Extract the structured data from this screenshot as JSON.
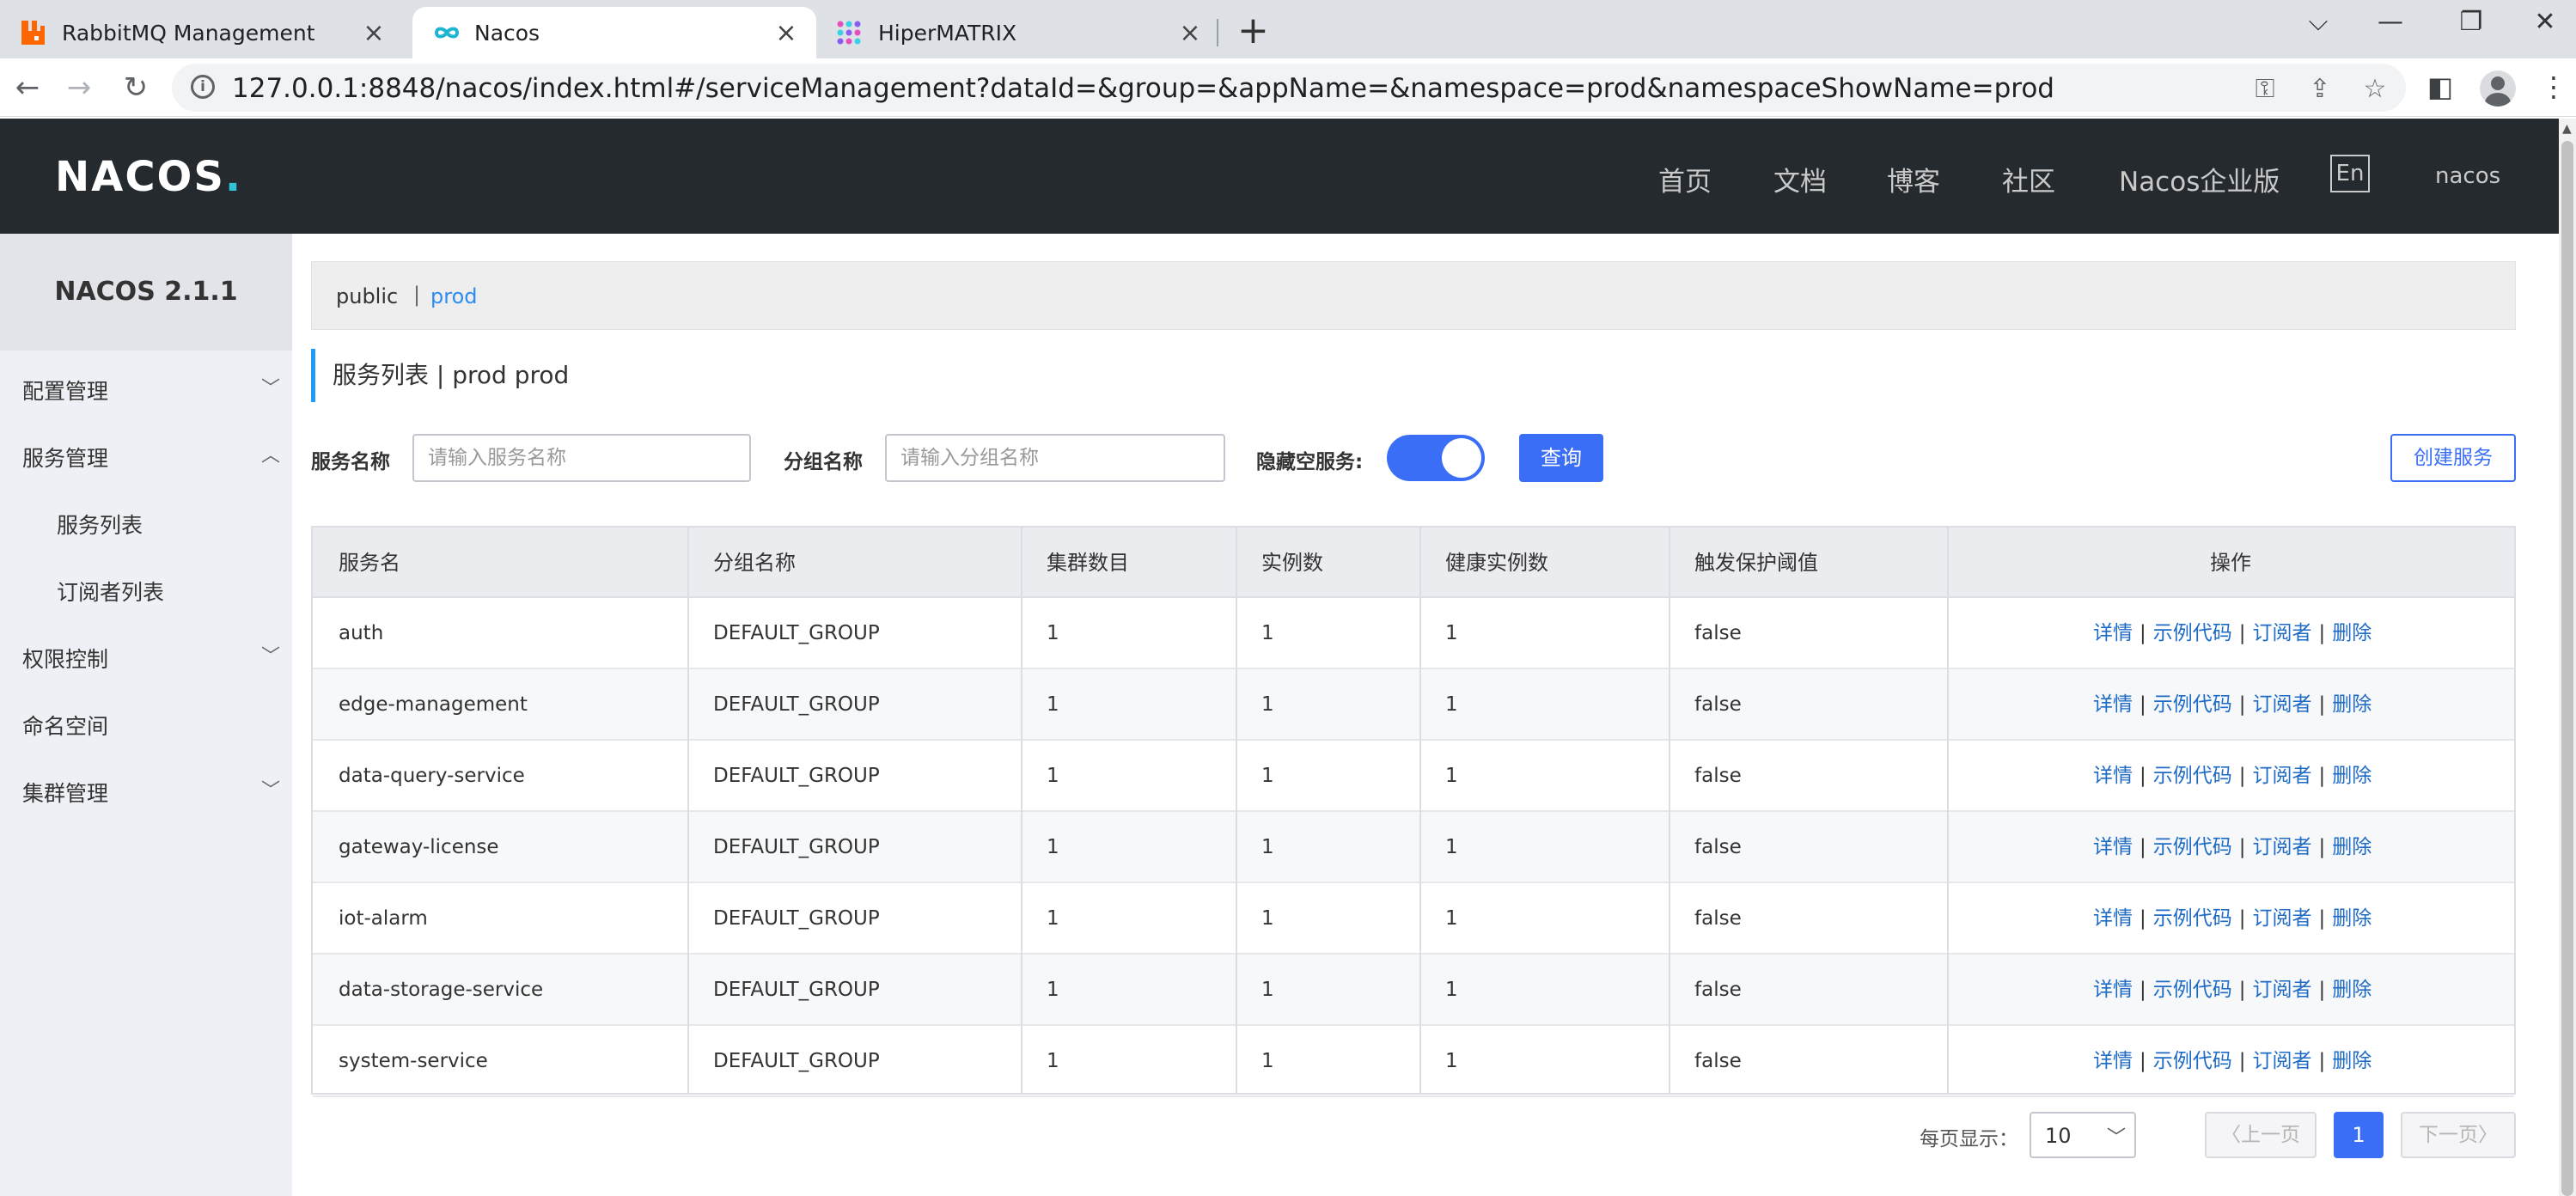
{
  "browser": {
    "tabs": [
      {
        "title": "RabbitMQ Management",
        "icon": "rabbitmq-favicon-icon"
      },
      {
        "title": "Nacos",
        "icon": "nacos-favicon-icon"
      },
      {
        "title": "HiperMATRIX",
        "icon": "hipermatrix-favicon-icon"
      }
    ],
    "url": "127.0.0.1:8848/nacos/index.html#/serviceManagement?dataId=&group=&appName=&namespace=prod&namespaceShowName=prod"
  },
  "header": {
    "logo": "NACOS",
    "nav": [
      "首页",
      "文档",
      "博客",
      "社区",
      "Nacos企业版"
    ],
    "lang": "En",
    "user": "nacos"
  },
  "sidebar": {
    "version": "NACOS 2.1.1",
    "items": [
      {
        "label": "配置管理"
      },
      {
        "label": "服务管理"
      },
      {
        "label": "服务列表"
      },
      {
        "label": "订阅者列表"
      },
      {
        "label": "权限控制"
      },
      {
        "label": "命名空间"
      },
      {
        "label": "集群管理"
      }
    ]
  },
  "namespaces": {
    "items": [
      "public",
      "prod"
    ],
    "separator": "|"
  },
  "page": {
    "title": "服务列表  |  prod  prod"
  },
  "filters": {
    "service_label": "服务名称",
    "service_placeholder": "请输入服务名称",
    "group_label": "分组名称",
    "group_placeholder": "请输入分组名称",
    "hide_empty_label": "隐藏空服务:",
    "hide_empty_on": true,
    "search_label": "查询",
    "create_label": "创建服务"
  },
  "table": {
    "headers": [
      "服务名",
      "分组名称",
      "集群数目",
      "实例数",
      "健康实例数",
      "触发保护阈值",
      "操作"
    ],
    "ops": [
      "详情",
      "示例代码",
      "订阅者",
      "删除"
    ],
    "ops_sep": "|",
    "rows": [
      [
        "auth",
        "DEFAULT_GROUP",
        "1",
        "1",
        "1",
        "false"
      ],
      [
        "edge-management",
        "DEFAULT_GROUP",
        "1",
        "1",
        "1",
        "false"
      ],
      [
        "data-query-service",
        "DEFAULT_GROUP",
        "1",
        "1",
        "1",
        "false"
      ],
      [
        "gateway-license",
        "DEFAULT_GROUP",
        "1",
        "1",
        "1",
        "false"
      ],
      [
        "iot-alarm",
        "DEFAULT_GROUP",
        "1",
        "1",
        "1",
        "false"
      ],
      [
        "data-storage-service",
        "DEFAULT_GROUP",
        "1",
        "1",
        "1",
        "false"
      ],
      [
        "system-service",
        "DEFAULT_GROUP",
        "1",
        "1",
        "1",
        "false"
      ]
    ]
  },
  "pagination": {
    "page_size_label": "每页显示：",
    "page_size": "10",
    "prev": "上一页",
    "next": "下一页",
    "current": "1"
  },
  "colors": {
    "header_bg": "#252a2f",
    "primary": "#3a6ef6",
    "link": "#1e6bc5",
    "accent": "#209bfa"
  }
}
